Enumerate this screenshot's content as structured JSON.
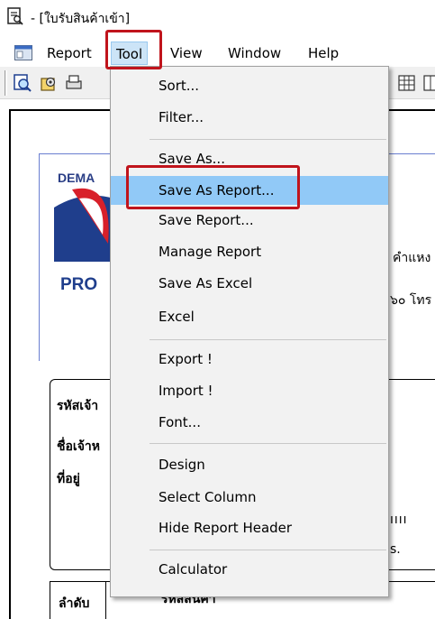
{
  "window": {
    "title": "- [ใบรับสินค้าเข้า]"
  },
  "menubar": {
    "items": [
      {
        "label": "Report"
      },
      {
        "label": "Tool"
      },
      {
        "label": "View"
      },
      {
        "label": "Window"
      },
      {
        "label": "Help"
      }
    ]
  },
  "toolbar": {
    "icons": [
      "zoom-icon",
      "open-icon",
      "print-icon",
      "grid-icon",
      "columns-icon"
    ]
  },
  "report": {
    "logo_small": "DEMA",
    "logo_text": "PRO",
    "address_line_1": "คำแหง",
    "address_line_2": "๖๐ โทร",
    "label_supplier_code": "รหัสเจ้า",
    "label_supplier_name": "ชื่อเจ้าห",
    "label_address": "ที่อยู่",
    "mid_digits": "ıııı",
    "mid_suffix": "s.",
    "col_no": "ลำดับ",
    "col_product_code": "รหัสสินค้า"
  },
  "tool_menu": {
    "items": [
      {
        "label": "Sort..."
      },
      {
        "label": "Filter..."
      },
      {
        "label": "Save As..."
      },
      {
        "label": "Save As Report..."
      },
      {
        "label": "Save Report..."
      },
      {
        "label": "Manage Report"
      },
      {
        "label": "Save As Excel"
      },
      {
        "label": "Excel"
      },
      {
        "label": "Export !"
      },
      {
        "label": "Import !"
      },
      {
        "label": "Font..."
      },
      {
        "label": "Design"
      },
      {
        "label": "Select Column"
      },
      {
        "label": "Hide Report Header"
      },
      {
        "label": "Calculator"
      }
    ],
    "highlighted_item": "Save As Report..."
  },
  "colors": {
    "menu_hover": "#91c9f7",
    "highlight_box": "#c0141c",
    "logo_blue": "#1f3e8c",
    "logo_red": "#d8202a"
  }
}
